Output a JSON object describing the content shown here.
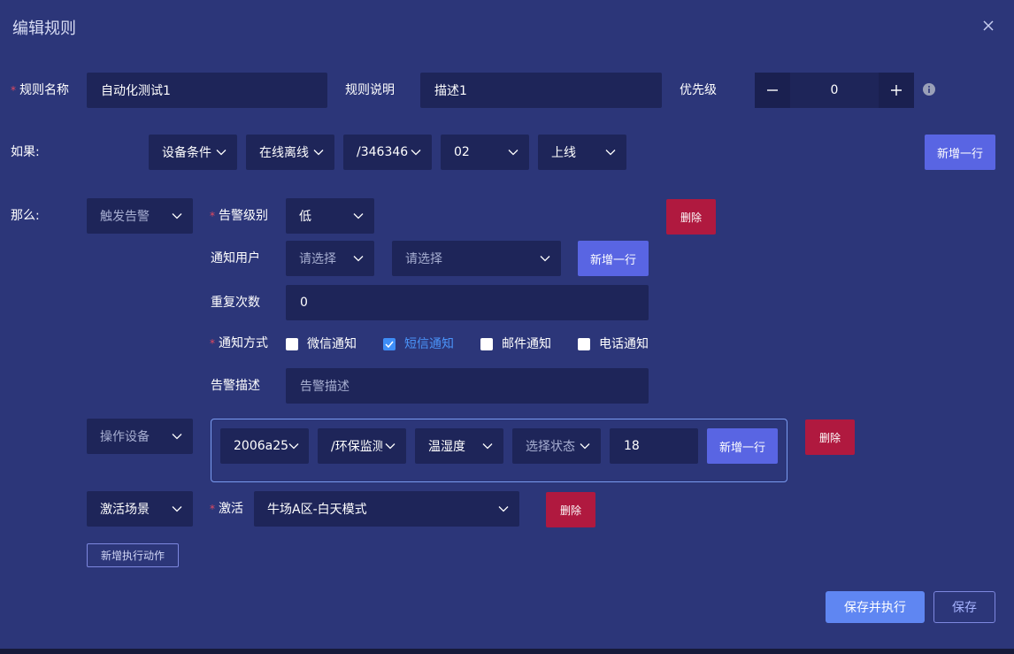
{
  "dialog": {
    "title": "编辑规则"
  },
  "rule": {
    "name_label": "规则名称",
    "name_value": "自动化测试1",
    "desc_label": "规则说明",
    "desc_value": "描述1",
    "priority_label": "优先级",
    "priority_value": "0"
  },
  "if_section": {
    "label": "如果:",
    "selects": [
      "设备条件",
      "在线离线",
      "/346346",
      "02",
      "上线"
    ],
    "add_row": "新增一行"
  },
  "then_section": {
    "label": "那么:",
    "action_type": "触发告警",
    "alarm_level_label": "告警级别",
    "alarm_level_value": "低",
    "delete_label": "删除",
    "notify_user_label": "通知用户",
    "notify_user_placeholder1": "请选择",
    "notify_user_placeholder2": "请选择",
    "add_row": "新增一行",
    "repeat_label": "重复次数",
    "repeat_value": "0",
    "notify_method_label": "通知方式",
    "methods": [
      {
        "label": "微信通知",
        "checked": false
      },
      {
        "label": "短信通知",
        "checked": true
      },
      {
        "label": "邮件通知",
        "checked": false
      },
      {
        "label": "电话通知",
        "checked": false
      }
    ],
    "alarm_desc_label": "告警描述",
    "alarm_desc_placeholder": "告警描述"
  },
  "device_action": {
    "type": "操作设备",
    "selects": [
      "2006a25",
      "/环保监测",
      "温湿度"
    ],
    "state_placeholder": "选择状态",
    "value": "18",
    "add_row": "新增一行",
    "delete_label": "删除"
  },
  "scene_action": {
    "type": "激活场景",
    "activate_label": "激活",
    "scene_value": "牛场A区-白天模式",
    "delete_label": "删除"
  },
  "add_action": "新增执行动作",
  "footer": {
    "save_execute": "保存并执行",
    "save": "保存"
  },
  "colors": {
    "background": "#2c3679",
    "input": "#1e2559",
    "primary": "#5965e3",
    "danger": "#b0193f",
    "checked": "#3e8ef7"
  }
}
